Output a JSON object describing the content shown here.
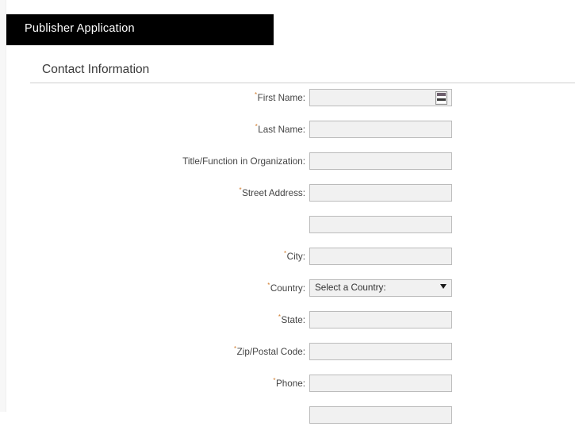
{
  "app": {
    "title": "Publisher Application",
    "title_bar_color": "#000000",
    "title_text_color": "#ffffff"
  },
  "section": {
    "heading": "Contact Information"
  },
  "theme": {
    "required_marker_color": "#d07a2a",
    "input_fill": "#f1f1f1",
    "input_border": "#bbbbbb",
    "page_background": "#ffffff",
    "rule_color": "#cfcfcf"
  },
  "form": {
    "required_marker": "*",
    "fields": [
      {
        "label": "First Name:",
        "required": true,
        "type": "text",
        "value": "",
        "placeholder": "",
        "has_autofill_button": true
      },
      {
        "label": "Last Name:",
        "required": true,
        "type": "text",
        "value": "",
        "placeholder": "",
        "has_autofill_button": false
      },
      {
        "label": "Title/Function in Organization:",
        "required": false,
        "type": "text",
        "value": "",
        "placeholder": "",
        "has_autofill_button": false
      },
      {
        "label": "Street Address:",
        "required": true,
        "type": "text",
        "value": "",
        "placeholder": "",
        "has_autofill_button": false
      },
      {
        "label": "",
        "required": false,
        "type": "text",
        "value": "",
        "placeholder": "",
        "has_autofill_button": false
      },
      {
        "label": "City:",
        "required": true,
        "type": "text",
        "value": "",
        "placeholder": "",
        "has_autofill_button": false
      },
      {
        "label": "Country:",
        "required": true,
        "type": "select",
        "value": "Select a Country:",
        "placeholder": "",
        "has_autofill_button": false
      },
      {
        "label": "State:",
        "required": true,
        "type": "text",
        "value": "",
        "placeholder": "",
        "has_autofill_button": false
      },
      {
        "label": "Zip/Postal Code:",
        "required": true,
        "type": "text",
        "value": "",
        "placeholder": "",
        "has_autofill_button": false
      },
      {
        "label": "Phone:",
        "required": true,
        "type": "text",
        "value": "",
        "placeholder": "",
        "has_autofill_button": false
      },
      {
        "label": "",
        "required": false,
        "type": "text",
        "value": "",
        "placeholder": "",
        "has_autofill_button": false
      }
    ]
  }
}
